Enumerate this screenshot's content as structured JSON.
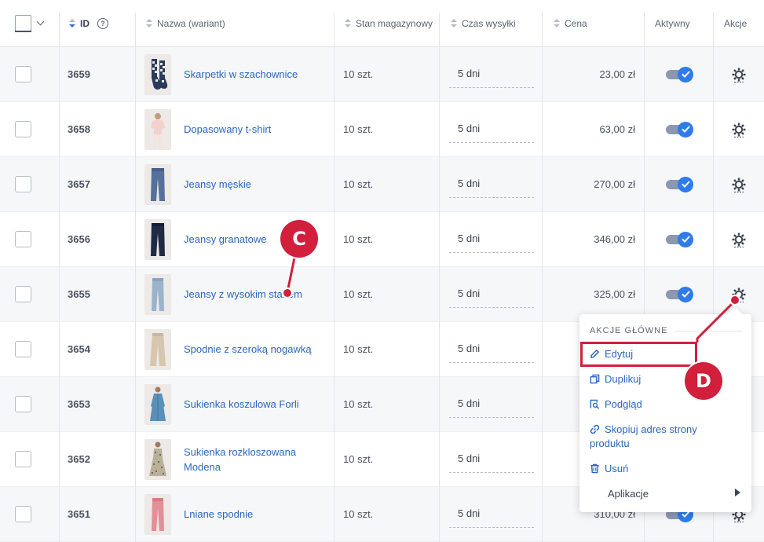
{
  "header": {
    "id": "ID",
    "help": "?",
    "name": "Nazwa (wariant)",
    "stock": "Stan magazynowy",
    "ship": "Czas wysyłki",
    "price": "Cena",
    "active": "Aktywny",
    "actions": "Akcje"
  },
  "rows": [
    {
      "id": "3659",
      "name": "Skarpetki w szachownice",
      "name2": "",
      "stock": "10 szt.",
      "ship": "5 dni",
      "price": "23,00 zł",
      "thumb": "socks"
    },
    {
      "id": "3658",
      "name": "Dopasowany t-shirt",
      "name2": "",
      "stock": "10 szt.",
      "ship": "5 dni",
      "price": "63,00 zł",
      "thumb": "tshirt"
    },
    {
      "id": "3657",
      "name": "Jeansy męskie",
      "name2": "",
      "stock": "10 szt.",
      "ship": "5 dni",
      "price": "270,00 zł",
      "thumb": "jeans"
    },
    {
      "id": "3656",
      "name": "Jeansy granatowe",
      "name2": "",
      "stock": "10 szt.",
      "ship": "5 dni",
      "price": "346,00 zł",
      "thumb": "jeans-dark"
    },
    {
      "id": "3655",
      "name": "Jeansy z wysokim stanem",
      "name2": "",
      "stock": "10 szt.",
      "ship": "5 dni",
      "price": "325,00 zł",
      "thumb": "jeans-light"
    },
    {
      "id": "3654",
      "name": "Spodnie z szeroką nogawką",
      "name2": "",
      "stock": "10 szt.",
      "ship": "5 dni",
      "price": "",
      "thumb": "pants-beige"
    },
    {
      "id": "3653",
      "name": "Sukienka koszulowa Forli",
      "name2": "",
      "stock": "10 szt.",
      "ship": "5 dni",
      "price": "",
      "thumb": "dress-blue"
    },
    {
      "id": "3652",
      "name": "Sukienka rozkloszowana",
      "name2": "Modena",
      "stock": "10 szt.",
      "ship": "5 dni",
      "price": "",
      "thumb": "dress-floral"
    },
    {
      "id": "3651",
      "name": "Lniane spodnie",
      "name2": "",
      "stock": "10 szt.",
      "ship": "5 dni",
      "price": "310,00 zł",
      "thumb": "pants-pink"
    }
  ],
  "menu": {
    "section": "AKCJE GŁÓWNE",
    "edit": "Edytuj",
    "duplicate": "Duplikuj",
    "preview": "Podgląd",
    "copy_url_1": "Skopiuj adres strony",
    "copy_url_2": "produktu",
    "delete": "Usuń",
    "apps": "Aplikacje"
  },
  "callouts": {
    "c": "C",
    "d": "D"
  },
  "colors": {
    "link": "#2a66c2",
    "accent": "#2f7bea",
    "callout": "#d11f3c"
  }
}
